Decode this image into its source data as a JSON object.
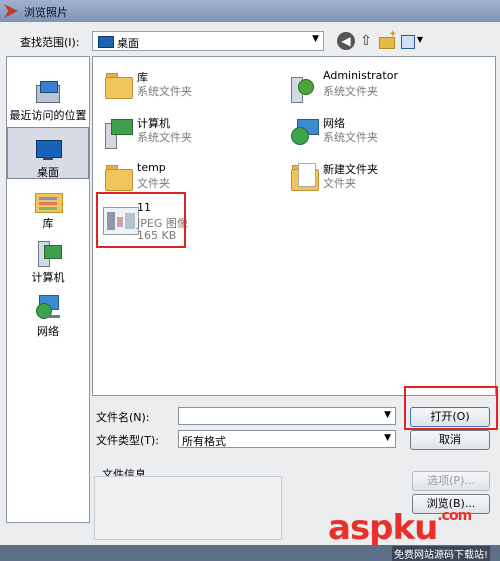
{
  "window": {
    "title": "浏览照片"
  },
  "toolbar": {
    "lookin_label": "查找范围(I):",
    "lookin_value": "桌面"
  },
  "places": [
    {
      "label": "最近访问的位置",
      "icon": "recent-places-icon"
    },
    {
      "label": "桌面",
      "icon": "desktop-icon",
      "selected": true
    },
    {
      "label": "库",
      "icon": "library-icon"
    },
    {
      "label": "计算机",
      "icon": "computer-icon"
    },
    {
      "label": "网络",
      "icon": "network-icon"
    }
  ],
  "files": [
    {
      "name": "库",
      "type": "系统文件夹",
      "icon": "library-folder-icon"
    },
    {
      "name": "Administrator",
      "type": "系统文件夹",
      "icon": "user-folder-icon"
    },
    {
      "name": "计算机",
      "type": "系统文件夹",
      "icon": "computer-icon"
    },
    {
      "name": "网络",
      "type": "系统文件夹",
      "icon": "network-icon"
    },
    {
      "name": "temp",
      "type": "文件夹",
      "icon": "folder-icon"
    },
    {
      "name": "新建文件夹",
      "type": "文件夹",
      "icon": "folder-icon"
    },
    {
      "name": "11",
      "type": "JPEG 图像",
      "size": "165 KB",
      "icon": "jpeg-thumbnail-icon"
    }
  ],
  "form": {
    "filename_label": "文件名(N):",
    "filename_value": "",
    "filetype_label": "文件类型(T):",
    "filetype_value": "所有格式"
  },
  "buttons": {
    "open": "打开(O)",
    "cancel": "取消",
    "options": "选项(P)...",
    "browse": "浏览(B)..."
  },
  "info": {
    "label": "文件信息"
  },
  "watermark": {
    "text": "aspku",
    "suffix": ".com",
    "sub": "免费网站源码下载站!"
  },
  "colors": {
    "highlight": "#e02424",
    "selection": "#d6dbe4"
  }
}
